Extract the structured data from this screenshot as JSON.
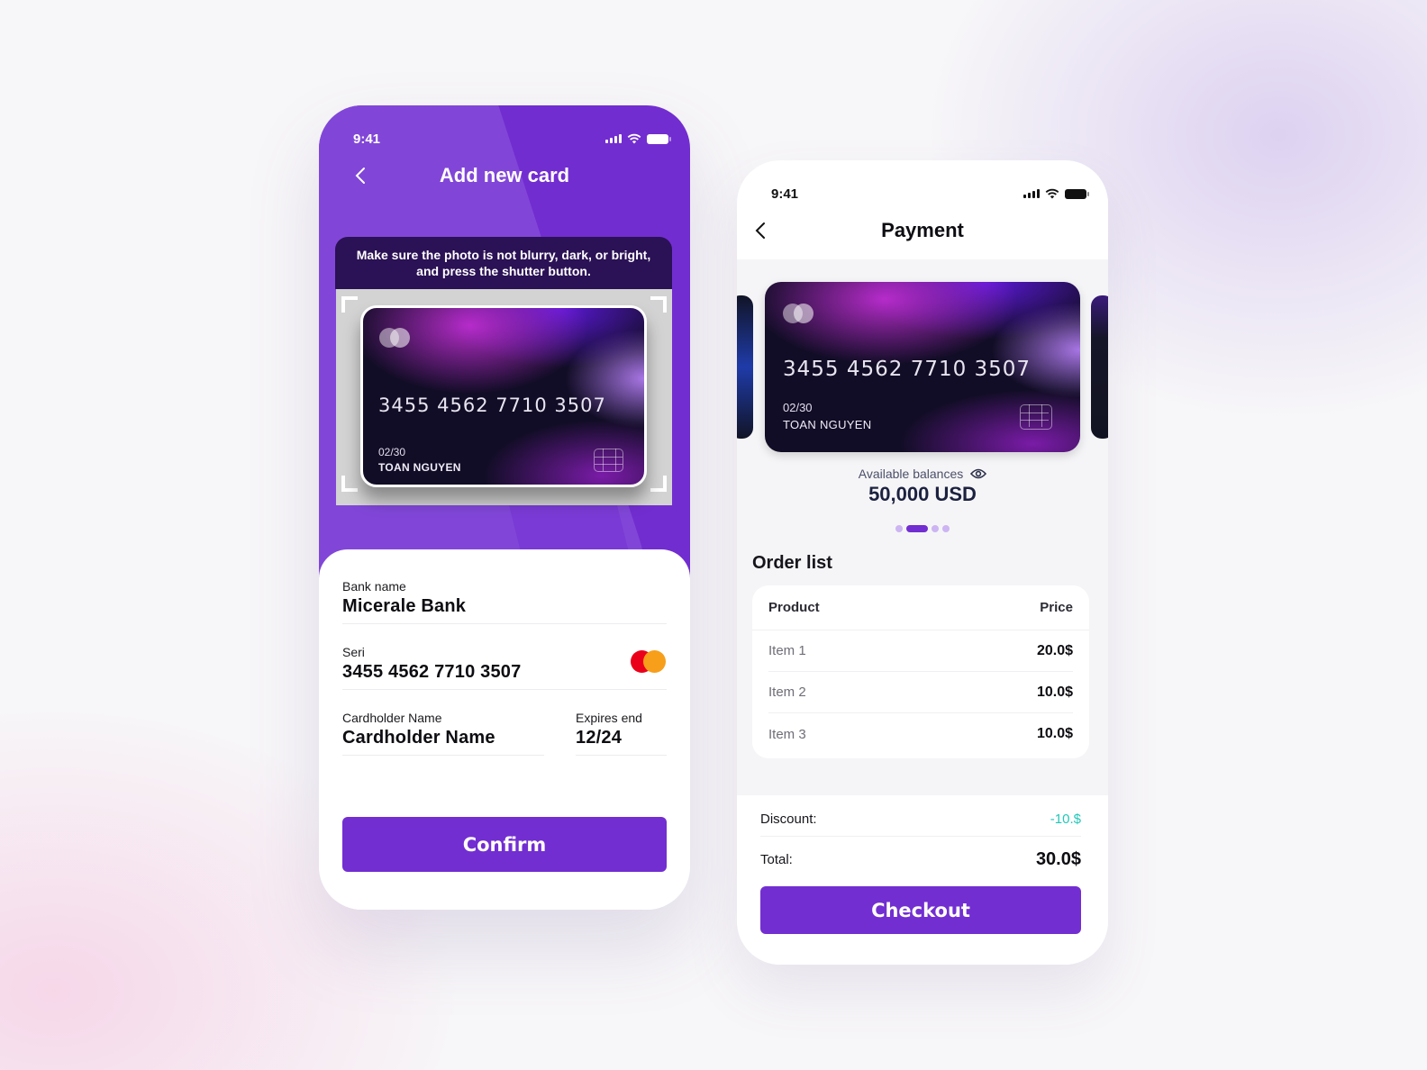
{
  "status_bar": {
    "time": "9:41"
  },
  "add_card_screen": {
    "title": "Add new card",
    "hint": "Make sure the photo is not blurry, dark, or bright, and press the shutter button.",
    "scanned_card": {
      "number": "3455 4562 7710 3507",
      "expiry": "02/30",
      "holder": "TOAN NGUYEN"
    },
    "fields": {
      "bank_name": {
        "label": "Bank name",
        "value": "Micerale Bank"
      },
      "seri": {
        "label": "Seri",
        "value": "3455 4562 7710 3507"
      },
      "cardholder": {
        "label": "Cardholder Name",
        "value": "Cardholder Name"
      },
      "expires": {
        "label": "Expires end",
        "value": "12/24"
      }
    },
    "confirm_label": "Confirm"
  },
  "payment_screen": {
    "title": "Payment",
    "card": {
      "number": "3455 4562 7710 3507",
      "expiry": "02/30",
      "holder": "TOAN NGUYEN"
    },
    "balance_label": "Available balances",
    "balance_value": "50,000 USD",
    "pager": {
      "count": 4,
      "active_index": 1
    },
    "order_list": {
      "title": "Order list",
      "columns": [
        "Product",
        "Price"
      ],
      "rows": [
        {
          "product": "Item 1",
          "price": "20.0$"
        },
        {
          "product": "Item 2",
          "price": "10.0$"
        },
        {
          "product": "Item 3",
          "price": "10.0$"
        }
      ]
    },
    "discount_label": "Discount:",
    "discount_value": "-10.$",
    "total_label": "Total:",
    "total_value": "30.0$",
    "checkout_label": "Checkout"
  },
  "colors": {
    "primary": "#722ed1",
    "header_purple": "#722dd0",
    "discount": "#22c7b8",
    "mastercard_red": "#eb001b",
    "mastercard_orange": "#f79e1b"
  }
}
